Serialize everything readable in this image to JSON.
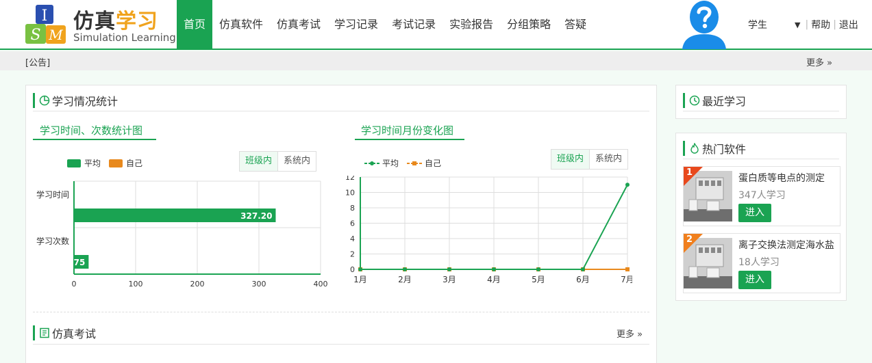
{
  "logo": {
    "cn_a": "仿真",
    "cn_b": "学习",
    "en": "Simulation Learning",
    "mark_top": "I",
    "mark_left": "S",
    "mark_right": "M"
  },
  "nav": [
    {
      "label": "首页",
      "active": true
    },
    {
      "label": "仿真软件"
    },
    {
      "label": "仿真考试"
    },
    {
      "label": "学习记录"
    },
    {
      "label": "考试记录"
    },
    {
      "label": "实验报告"
    },
    {
      "label": "分组策略"
    },
    {
      "label": "答疑"
    }
  ],
  "user": {
    "name": "学生",
    "help": "帮助",
    "logout": "退出"
  },
  "notice": {
    "label": "[公告]",
    "more": "更多"
  },
  "stats": {
    "title": "学习情况统计",
    "left": {
      "subtitle": "学习时间、次数统计图",
      "legend_avg": "平均",
      "legend_self": "自己",
      "toggle_class": "班级内",
      "toggle_system": "系统内"
    },
    "right": {
      "subtitle": "学习时间月份变化图",
      "legend_avg": "平均",
      "legend_self": "自己",
      "toggle_class": "班级内",
      "toggle_system": "系统内"
    }
  },
  "exam": {
    "title": "仿真考试",
    "more": "更多"
  },
  "recent": {
    "title": "最近学习"
  },
  "hot": {
    "title": "热门软件",
    "items": [
      {
        "rank": "1",
        "name": "蛋白质等电点的测定",
        "count": "347人学习",
        "button": "进入"
      },
      {
        "rank": "2",
        "name": "离子交换法测定海水盐",
        "count": "18人学习",
        "button": "进入"
      }
    ]
  },
  "colors": {
    "primary": "#1aa352",
    "orange": "#e8891d"
  },
  "chart_data": [
    {
      "type": "bar",
      "orientation": "horizontal",
      "categories": [
        "学习时间",
        "学习次数"
      ],
      "series": [
        {
          "name": "平均",
          "values": [
            327.2,
            23.75
          ]
        }
      ],
      "data_labels": [
        "327.20",
        "75"
      ],
      "xlim": [
        0,
        400
      ],
      "xticks": [
        "0",
        "100",
        "200",
        "300",
        "400"
      ],
      "grid": true,
      "legend": "top-left"
    },
    {
      "type": "line",
      "x": [
        "1月",
        "2月",
        "3月",
        "4月",
        "5月",
        "6月",
        "7月"
      ],
      "series": [
        {
          "name": "平均",
          "values": [
            0,
            0,
            0,
            0,
            0,
            0,
            11
          ]
        },
        {
          "name": "自己",
          "values": [
            0,
            0,
            0,
            0,
            0,
            0,
            0
          ]
        }
      ],
      "ylim": [
        0,
        12
      ],
      "yticks": [
        "0",
        "2",
        "4",
        "6",
        "8",
        "10",
        "12"
      ],
      "grid": true,
      "legend": "top-left"
    }
  ]
}
